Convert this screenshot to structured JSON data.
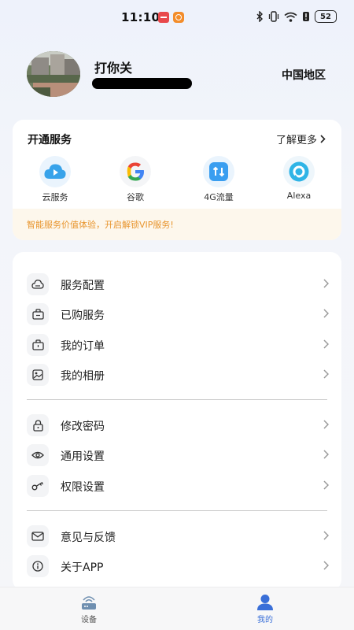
{
  "status_bar": {
    "time": "11:10",
    "battery": "52"
  },
  "profile": {
    "name": "打你关",
    "region": "中国地区"
  },
  "services": {
    "title": "开通服务",
    "learn_more": "了解更多",
    "items": [
      {
        "label": "云服务",
        "icon": "cloud-play-icon"
      },
      {
        "label": "谷歌",
        "icon": "google-icon"
      },
      {
        "label": "4G流量",
        "icon": "4g-data-icon"
      },
      {
        "label": "Alexa",
        "icon": "alexa-icon"
      }
    ],
    "vip_text": "智能服务价值体验，开启解锁VIP服务!"
  },
  "menu": {
    "group1": [
      {
        "label": "服务配置",
        "icon": "cloud-config-icon"
      },
      {
        "label": "已购服务",
        "icon": "purchased-bag-icon"
      },
      {
        "label": "我的订单",
        "icon": "order-bag-icon"
      },
      {
        "label": "我的相册",
        "icon": "album-icon"
      }
    ],
    "group2": [
      {
        "label": "修改密码",
        "icon": "lock-icon"
      },
      {
        "label": "通用设置",
        "icon": "eye-icon"
      },
      {
        "label": "权限设置",
        "icon": "key-icon"
      }
    ],
    "group3": [
      {
        "label": "意见与反馈",
        "icon": "mail-icon"
      },
      {
        "label": "关于APP",
        "icon": "info-icon"
      }
    ]
  },
  "bottom_nav": {
    "devices": "设备",
    "mine": "我的"
  },
  "colors": {
    "accent": "#3a6fd8",
    "vip_text": "#e8952e",
    "vip_bg": "#fdf7ec",
    "nav_inactive": "#555555"
  }
}
